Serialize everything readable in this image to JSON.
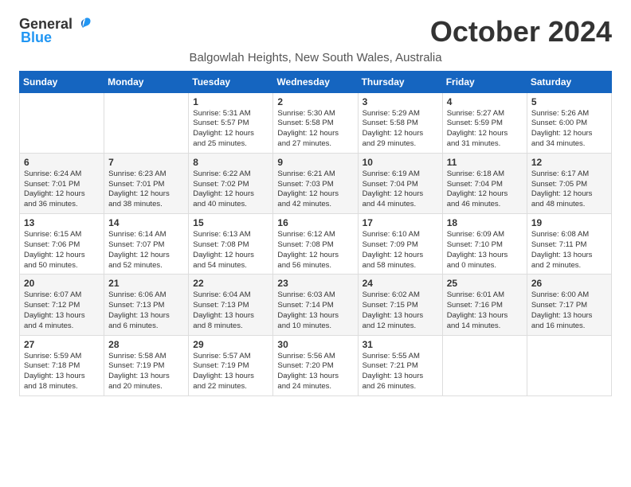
{
  "logo": {
    "general": "General",
    "blue": "Blue"
  },
  "title": "October 2024",
  "location": "Balgowlah Heights, New South Wales, Australia",
  "weekdays": [
    "Sunday",
    "Monday",
    "Tuesday",
    "Wednesday",
    "Thursday",
    "Friday",
    "Saturday"
  ],
  "weeks": [
    [
      {
        "day": "",
        "info": ""
      },
      {
        "day": "",
        "info": ""
      },
      {
        "day": "1",
        "info": "Sunrise: 5:31 AM\nSunset: 5:57 PM\nDaylight: 12 hours\nand 25 minutes."
      },
      {
        "day": "2",
        "info": "Sunrise: 5:30 AM\nSunset: 5:58 PM\nDaylight: 12 hours\nand 27 minutes."
      },
      {
        "day": "3",
        "info": "Sunrise: 5:29 AM\nSunset: 5:58 PM\nDaylight: 12 hours\nand 29 minutes."
      },
      {
        "day": "4",
        "info": "Sunrise: 5:27 AM\nSunset: 5:59 PM\nDaylight: 12 hours\nand 31 minutes."
      },
      {
        "day": "5",
        "info": "Sunrise: 5:26 AM\nSunset: 6:00 PM\nDaylight: 12 hours\nand 34 minutes."
      }
    ],
    [
      {
        "day": "6",
        "info": "Sunrise: 6:24 AM\nSunset: 7:01 PM\nDaylight: 12 hours\nand 36 minutes."
      },
      {
        "day": "7",
        "info": "Sunrise: 6:23 AM\nSunset: 7:01 PM\nDaylight: 12 hours\nand 38 minutes."
      },
      {
        "day": "8",
        "info": "Sunrise: 6:22 AM\nSunset: 7:02 PM\nDaylight: 12 hours\nand 40 minutes."
      },
      {
        "day": "9",
        "info": "Sunrise: 6:21 AM\nSunset: 7:03 PM\nDaylight: 12 hours\nand 42 minutes."
      },
      {
        "day": "10",
        "info": "Sunrise: 6:19 AM\nSunset: 7:04 PM\nDaylight: 12 hours\nand 44 minutes."
      },
      {
        "day": "11",
        "info": "Sunrise: 6:18 AM\nSunset: 7:04 PM\nDaylight: 12 hours\nand 46 minutes."
      },
      {
        "day": "12",
        "info": "Sunrise: 6:17 AM\nSunset: 7:05 PM\nDaylight: 12 hours\nand 48 minutes."
      }
    ],
    [
      {
        "day": "13",
        "info": "Sunrise: 6:15 AM\nSunset: 7:06 PM\nDaylight: 12 hours\nand 50 minutes."
      },
      {
        "day": "14",
        "info": "Sunrise: 6:14 AM\nSunset: 7:07 PM\nDaylight: 12 hours\nand 52 minutes."
      },
      {
        "day": "15",
        "info": "Sunrise: 6:13 AM\nSunset: 7:08 PM\nDaylight: 12 hours\nand 54 minutes."
      },
      {
        "day": "16",
        "info": "Sunrise: 6:12 AM\nSunset: 7:08 PM\nDaylight: 12 hours\nand 56 minutes."
      },
      {
        "day": "17",
        "info": "Sunrise: 6:10 AM\nSunset: 7:09 PM\nDaylight: 12 hours\nand 58 minutes."
      },
      {
        "day": "18",
        "info": "Sunrise: 6:09 AM\nSunset: 7:10 PM\nDaylight: 13 hours\nand 0 minutes."
      },
      {
        "day": "19",
        "info": "Sunrise: 6:08 AM\nSunset: 7:11 PM\nDaylight: 13 hours\nand 2 minutes."
      }
    ],
    [
      {
        "day": "20",
        "info": "Sunrise: 6:07 AM\nSunset: 7:12 PM\nDaylight: 13 hours\nand 4 minutes."
      },
      {
        "day": "21",
        "info": "Sunrise: 6:06 AM\nSunset: 7:13 PM\nDaylight: 13 hours\nand 6 minutes."
      },
      {
        "day": "22",
        "info": "Sunrise: 6:04 AM\nSunset: 7:13 PM\nDaylight: 13 hours\nand 8 minutes."
      },
      {
        "day": "23",
        "info": "Sunrise: 6:03 AM\nSunset: 7:14 PM\nDaylight: 13 hours\nand 10 minutes."
      },
      {
        "day": "24",
        "info": "Sunrise: 6:02 AM\nSunset: 7:15 PM\nDaylight: 13 hours\nand 12 minutes."
      },
      {
        "day": "25",
        "info": "Sunrise: 6:01 AM\nSunset: 7:16 PM\nDaylight: 13 hours\nand 14 minutes."
      },
      {
        "day": "26",
        "info": "Sunrise: 6:00 AM\nSunset: 7:17 PM\nDaylight: 13 hours\nand 16 minutes."
      }
    ],
    [
      {
        "day": "27",
        "info": "Sunrise: 5:59 AM\nSunset: 7:18 PM\nDaylight: 13 hours\nand 18 minutes."
      },
      {
        "day": "28",
        "info": "Sunrise: 5:58 AM\nSunset: 7:19 PM\nDaylight: 13 hours\nand 20 minutes."
      },
      {
        "day": "29",
        "info": "Sunrise: 5:57 AM\nSunset: 7:19 PM\nDaylight: 13 hours\nand 22 minutes."
      },
      {
        "day": "30",
        "info": "Sunrise: 5:56 AM\nSunset: 7:20 PM\nDaylight: 13 hours\nand 24 minutes."
      },
      {
        "day": "31",
        "info": "Sunrise: 5:55 AM\nSunset: 7:21 PM\nDaylight: 13 hours\nand 26 minutes."
      },
      {
        "day": "",
        "info": ""
      },
      {
        "day": "",
        "info": ""
      }
    ]
  ]
}
